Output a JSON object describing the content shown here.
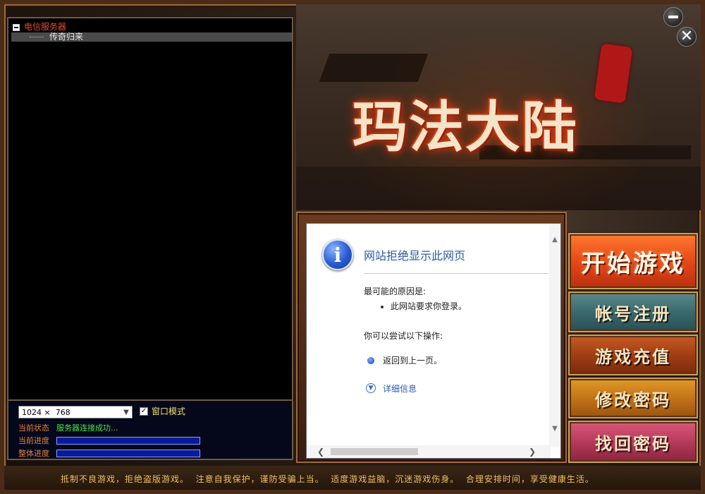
{
  "server_tree": {
    "root_label": "电信服务器",
    "child_label": "传奇归来"
  },
  "settings": {
    "resolution": "1024 ×  768",
    "window_mode_checked": true,
    "window_mode_label": "窗口模式"
  },
  "status": {
    "state_label": "当前状态",
    "state_value": "服务器连接成功...",
    "current_progress_label": "当前进度",
    "current_progress": 0,
    "overall_progress_label": "整体进度",
    "overall_progress": 0
  },
  "banner": {
    "logo_text": "玛法大陆"
  },
  "browser": {
    "title": "网站拒绝显示此网页",
    "reason_heading": "最可能的原因是:",
    "reason_item": "此网站要求你登录。",
    "try_heading": "你可以尝试以下操作:",
    "go_back": "返回到上一页。",
    "details": "详细信息"
  },
  "actions": {
    "start": "开始游戏",
    "register": "帐号注册",
    "recharge": "游戏充值",
    "change_password": "修改密码",
    "recover_password": "找回密码"
  },
  "notice": "抵制不良游戏，拒绝盗版游戏。  注意自我保护，谨防受骗上当。  适度游戏益脑，沉迷游戏伤身。  合理安排时间，享受健康生活。",
  "colors": {
    "tree_root": "#e05030",
    "status_value": "#50e050",
    "progress_bar": "#0a1a9a",
    "browser_title": "#2a5aa8"
  }
}
